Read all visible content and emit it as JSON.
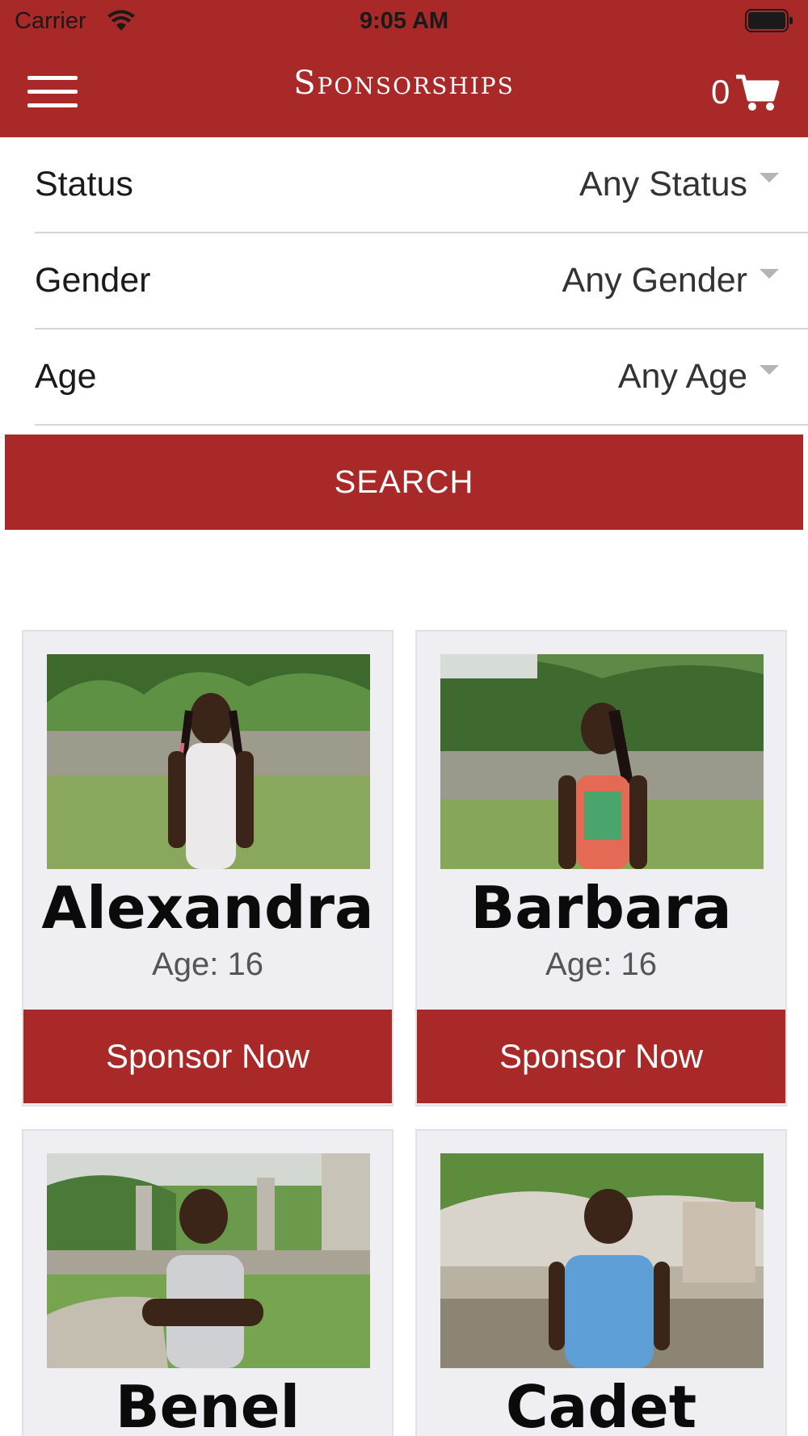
{
  "status_bar": {
    "carrier": "Carrier",
    "time": "9:05 AM"
  },
  "header": {
    "title": "Sponsorships",
    "cart_count": "0"
  },
  "filters": [
    {
      "label": "Status",
      "value": "Any Status"
    },
    {
      "label": "Gender",
      "value": "Any Gender"
    },
    {
      "label": "Age",
      "value": "Any Age"
    }
  ],
  "search_label": "SEARCH",
  "cards": [
    {
      "name": "Alexandra",
      "age": "Age: 16",
      "button": "Sponsor Now"
    },
    {
      "name": "Barbara",
      "age": "Age: 16",
      "button": "Sponsor Now"
    },
    {
      "name": "Benel",
      "age": "",
      "button": ""
    },
    {
      "name": "Cadet",
      "age": "",
      "button": ""
    }
  ],
  "colors": {
    "brand": "#a92828",
    "card_bg": "#efeff3"
  }
}
